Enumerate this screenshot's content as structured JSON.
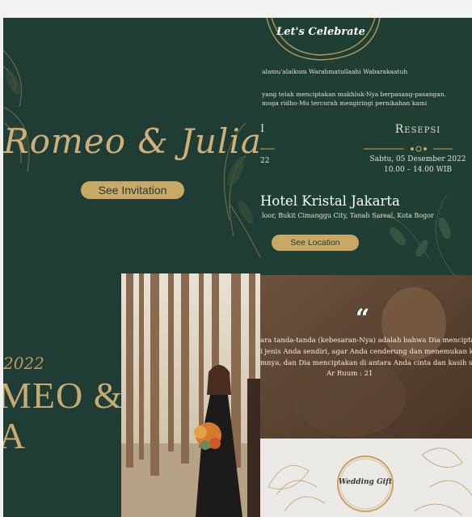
{
  "left": {
    "couple": "Romeo & Julia",
    "see_invitation": "See Invitation",
    "year": "2022",
    "big_line1": "MEO &",
    "big_line2": "A"
  },
  "event": {
    "title": "Let's Celebrate",
    "salam": "alamu'alaikum Warahmatullaahi Wabarakaatuh",
    "ayat_line1": "yang telah menciptakan makhluk-Nya berpasang-pasangan.",
    "ayat_line2": "moga ridho-Mu tercurah mengiringi pernikahan kami",
    "akad_label": "I",
    "akad_date": "22",
    "resepsi_label": "Resepsi",
    "resepsi_date": "Sabtu, 05 Desember 2022",
    "resepsi_time": "10.00 – 14.00 WIB",
    "venue": "Hotel Kristal Jakarta",
    "address": "loor, Bukit Cimanggu City, Tanah Sareal, Kota Bogor",
    "see_location": "See Location"
  },
  "quote": {
    "mark": "“",
    "line1": "ara tanda-tanda (kebesaran-Nya) adalah bahwa Dia menciptakan u",
    "line2": "i jenis Anda sendiri, agar Anda cenderung dan menemukan keda",
    "line3": "mnya, dan Dia menciptakan di antara Anda cinta dan kasih sayan",
    "ref": "Ar Ruum : 21"
  },
  "gift": {
    "title": "Wedding Gift"
  },
  "colors": {
    "dark_green": "#1f3d34",
    "gold": "#c9a865",
    "cream_text": "#e6e0d2"
  }
}
